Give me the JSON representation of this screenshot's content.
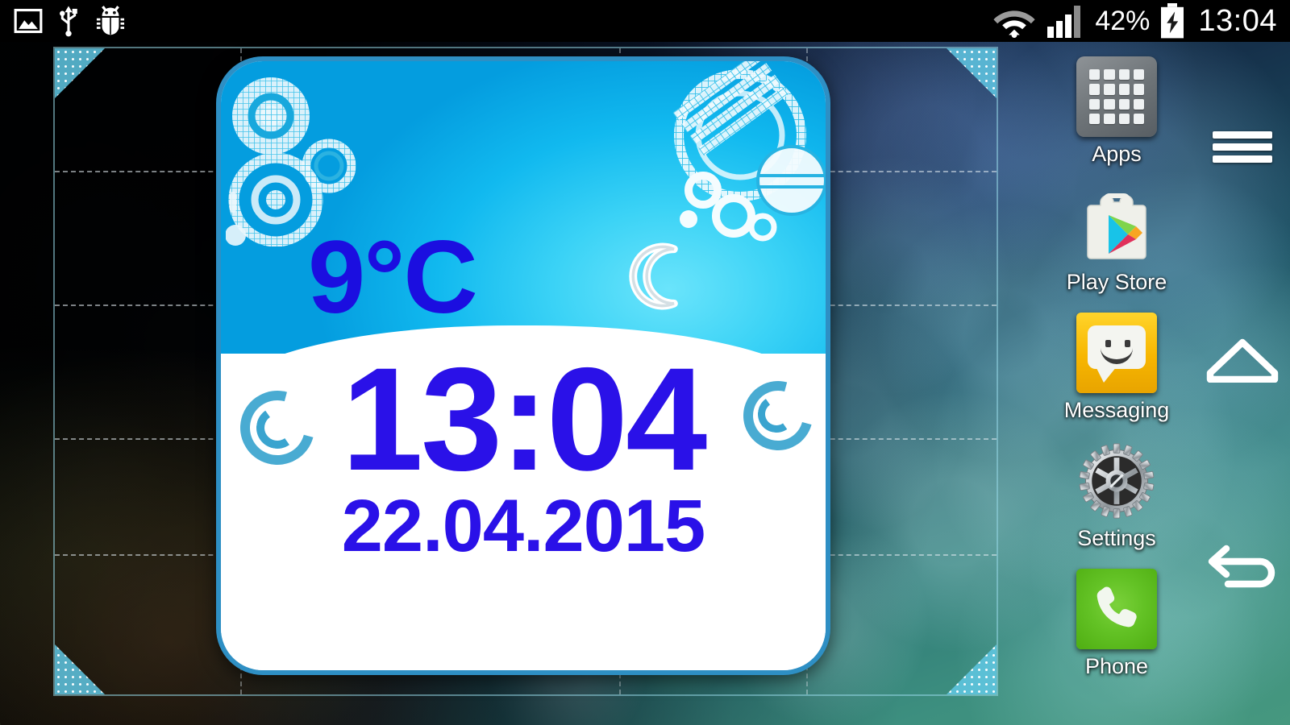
{
  "status_bar": {
    "left_icons": [
      {
        "name": "screenshot-image-icon",
        "glyph": "image"
      },
      {
        "name": "usb-icon",
        "glyph": "usb"
      },
      {
        "name": "android-debug-bug-icon",
        "glyph": "bug"
      }
    ],
    "wifi_icon": "wifi-icon",
    "signal_icon": "signal-bars-icon",
    "battery_percent": "42%",
    "battery_icon": "battery-charging-icon",
    "clock": "13:04"
  },
  "widget": {
    "type": "weather-clock-widget",
    "temperature": "9°C",
    "weather_condition_icon": "crescent-moon-icon",
    "time": "13:04",
    "date": "22.04.2015",
    "colors": {
      "sky_top": "#11b9ef",
      "sky_highlight": "#6ae4fb",
      "border": "#2e8fc4",
      "panel": "#ffffff",
      "text_blue": "#2a11e8",
      "swirl": "#3aa4cf"
    },
    "selection_frame": {
      "active": true,
      "handle_color": "#60c8e4",
      "border_color": "#96d7e6"
    }
  },
  "apps": [
    {
      "label": "Apps",
      "icon": "apps-grid-icon",
      "color": "#6e7478"
    },
    {
      "label": "Play Store",
      "icon": "play-store-icon",
      "color": "#f1f1ec"
    },
    {
      "label": "Messaging",
      "icon": "messaging-icon",
      "color": "#f7b600"
    },
    {
      "label": "Settings",
      "icon": "settings-gear-icon",
      "color": "#b9bec2"
    },
    {
      "label": "Phone",
      "icon": "phone-handset-icon",
      "color": "#63c225"
    }
  ],
  "nav_bar": [
    {
      "name": "menu-button",
      "icon": "hamburger-menu-icon"
    },
    {
      "name": "home-button",
      "icon": "home-house-icon"
    },
    {
      "name": "back-button",
      "icon": "back-arrow-icon"
    }
  ]
}
